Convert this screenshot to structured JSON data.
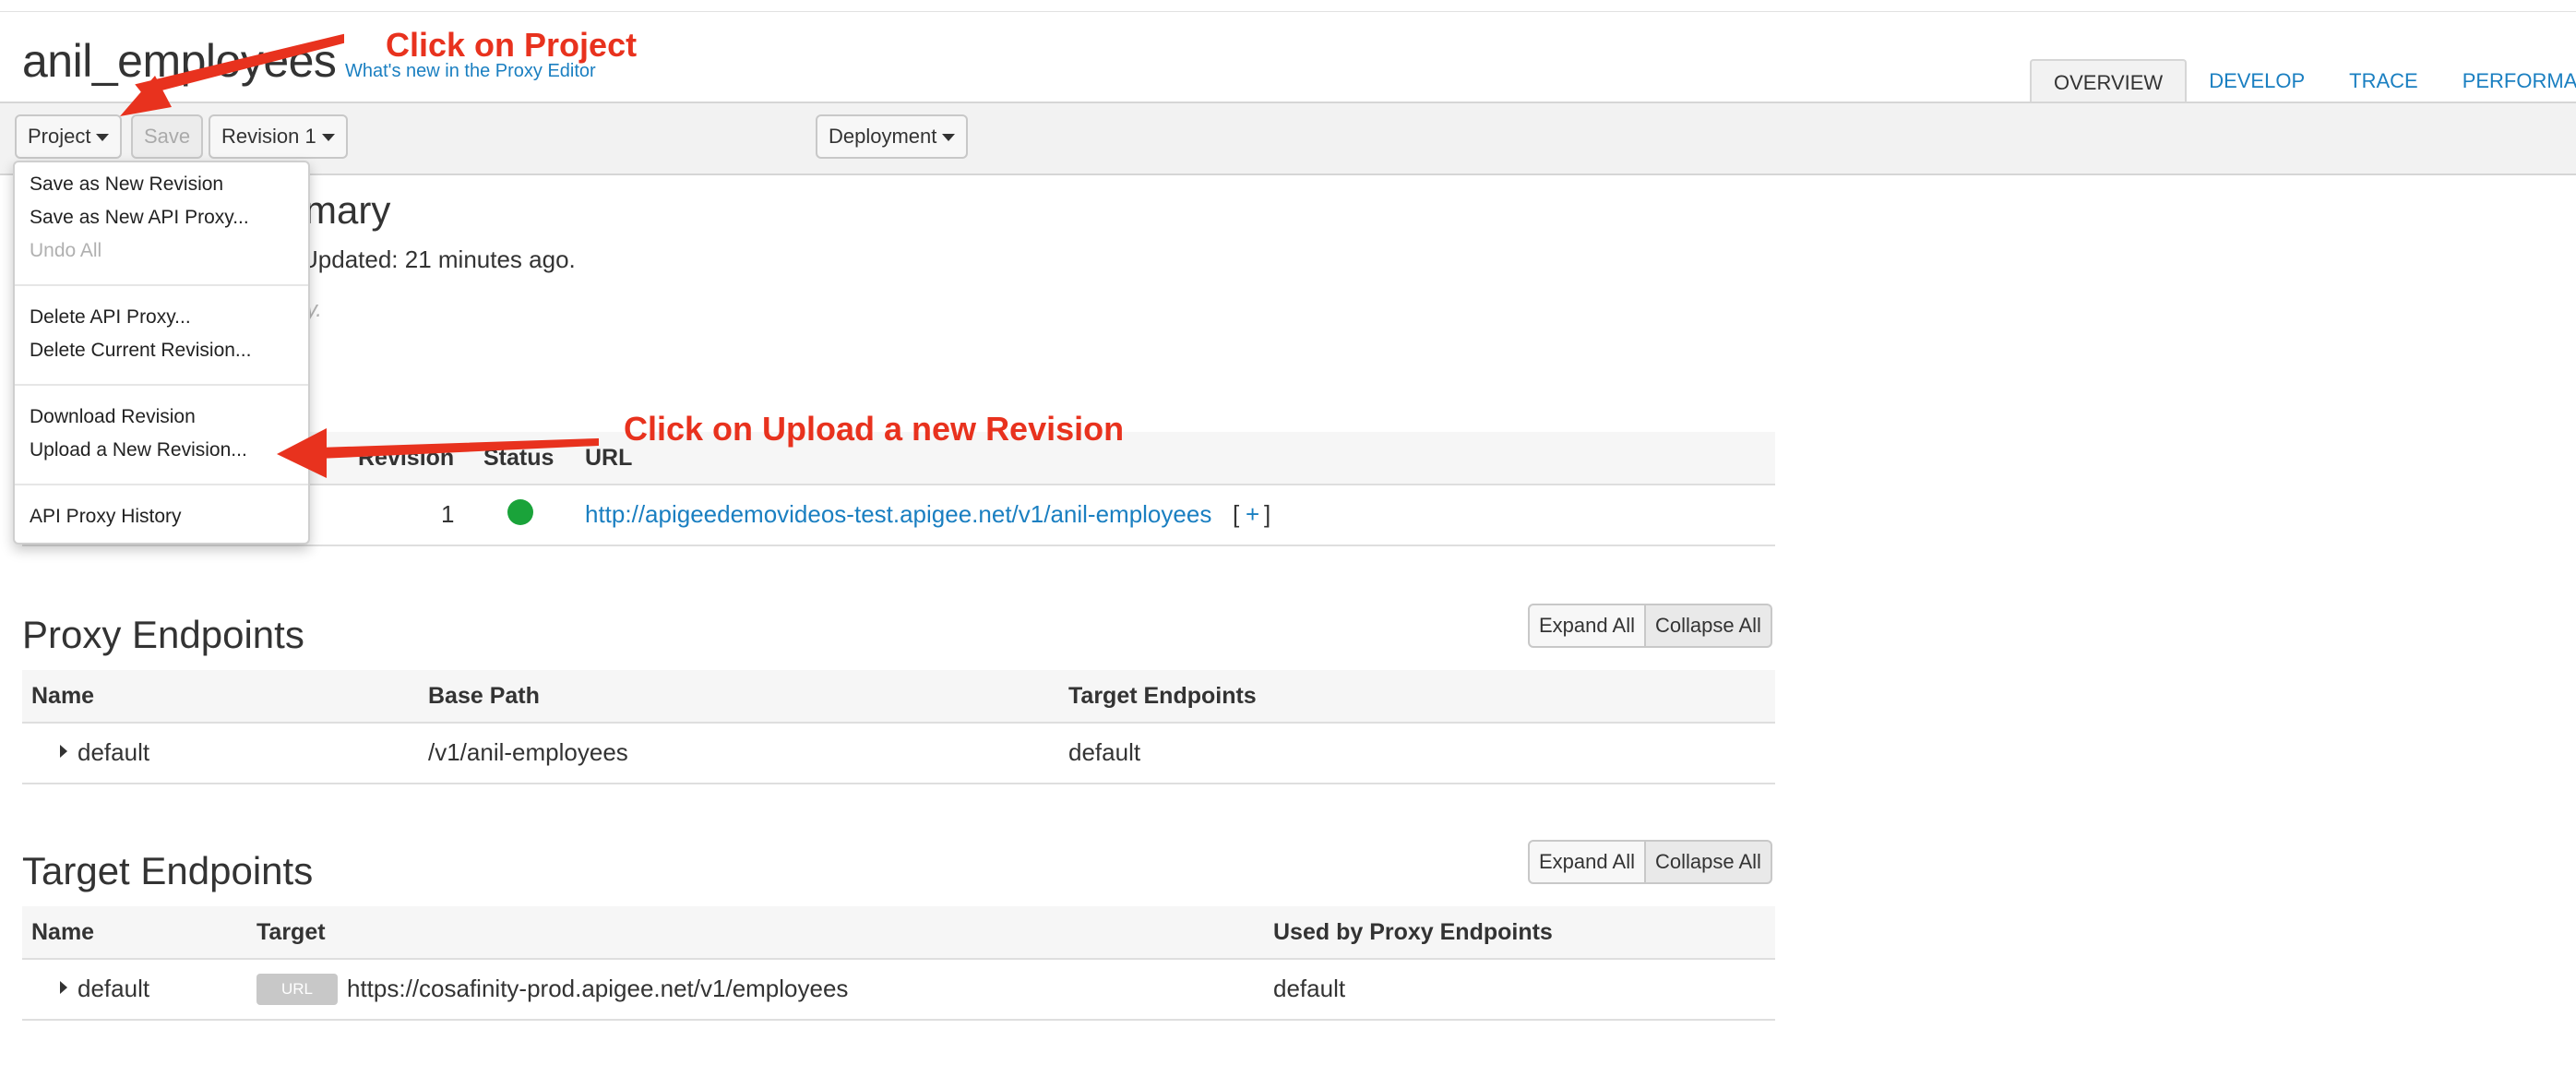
{
  "header": {
    "title": "anil_employees",
    "whats_new": "What's new in the Proxy Editor"
  },
  "tabs": [
    {
      "label": "OVERVIEW",
      "active": true
    },
    {
      "label": "DEVELOP",
      "active": false
    },
    {
      "label": "TRACE",
      "active": false
    },
    {
      "label": "PERFORMA",
      "active": false
    }
  ],
  "toolbar": {
    "project_label": "Project",
    "save_label": "Save",
    "revision_label": "Revision 1",
    "deployment_label": "Deployment"
  },
  "project_menu": {
    "items": [
      "Save as New Revision",
      "Save as New API Proxy...",
      "Undo All",
      "Delete API Proxy...",
      "Delete Current Revision...",
      "Download Revision",
      "Upload a New Revision...",
      "API Proxy History"
    ]
  },
  "summary": {
    "heading_visible": "mary",
    "updated_visible": "Updated: 21 minutes ago.",
    "description_visible": "y."
  },
  "deployments": {
    "columns": {
      "revision": "Revision",
      "status": "Status",
      "url": "URL"
    },
    "rows": [
      {
        "revision": "1",
        "status_color": "#1aa33a",
        "url": "http://apigeedemovideos-test.apigee.net/v1/anil-employees",
        "open": "[",
        "plus": "+",
        "close": "]"
      }
    ]
  },
  "proxy_endpoints": {
    "heading": "Proxy Endpoints",
    "expand_all": "Expand All",
    "collapse_all": "Collapse All",
    "columns": {
      "name": "Name",
      "base_path": "Base Path",
      "target_endpoints": "Target Endpoints"
    },
    "rows": [
      {
        "name": "default",
        "base_path": "/v1/anil-employees",
        "target_endpoints": "default"
      }
    ]
  },
  "target_endpoints": {
    "heading": "Target Endpoints",
    "expand_all": "Expand All",
    "collapse_all": "Collapse All",
    "columns": {
      "name": "Name",
      "target": "Target",
      "used_by": "Used by Proxy Endpoints"
    },
    "rows": [
      {
        "name": "default",
        "badge": "URL",
        "target": "https://cosafinity-prod.apigee.net/v1/employees",
        "used_by": "default"
      }
    ]
  },
  "annotations": {
    "click_project": "Click on Project",
    "click_upload": "Click on Upload a new Revision",
    "color": "#e8321e"
  }
}
